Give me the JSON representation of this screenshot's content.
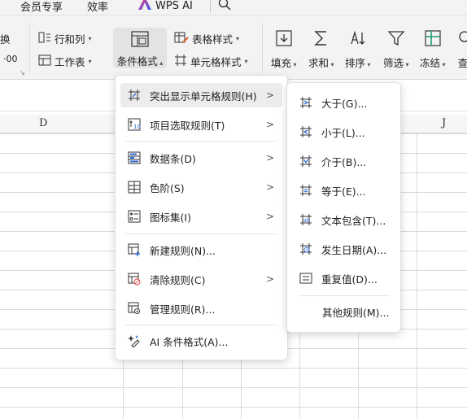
{
  "tabs": {
    "member": "会员专享",
    "efficiency": "效率",
    "wps_ai": "WPS AI"
  },
  "ribbon": {
    "left_partial_top": "换",
    "left_partial_bottom": "·00",
    "row_col": "行和列",
    "worksheet": "工作表",
    "conditional_format": "条件格式",
    "table_style": "表格样式",
    "cell_style": "单元格样式",
    "fill": "填充",
    "sum": "求和",
    "sort": "排序",
    "filter": "筛选",
    "freeze": "冻结",
    "find_partial": "查"
  },
  "columns": {
    "d": "D",
    "j": "J"
  },
  "menu": {
    "items": [
      {
        "label": "突出显示单元格规则(H)",
        "icon": "highlight-rules-icon",
        "has_submenu": true,
        "active": true
      },
      {
        "label": "项目选取规则(T)",
        "icon": "top-bottom-rules-icon",
        "has_submenu": true
      },
      {
        "label": "数据条(D)",
        "icon": "data-bars-icon",
        "has_submenu": true
      },
      {
        "label": "色阶(S)",
        "icon": "color-scales-icon",
        "has_submenu": true
      },
      {
        "label": "图标集(I)",
        "icon": "icon-sets-icon",
        "has_submenu": true
      },
      {
        "label": "新建规则(N)...",
        "icon": "new-rule-icon",
        "has_submenu": false
      },
      {
        "label": "清除规则(C)",
        "icon": "clear-rules-icon",
        "has_submenu": true
      },
      {
        "label": "管理规则(R)...",
        "icon": "manage-rules-icon",
        "has_submenu": false
      },
      {
        "label": "AI 条件格式(A)...",
        "icon": "ai-format-icon",
        "has_submenu": false
      }
    ]
  },
  "submenu": {
    "items": [
      {
        "label": "大于(G)...",
        "icon": "greater-than-icon"
      },
      {
        "label": "小于(L)...",
        "icon": "less-than-icon"
      },
      {
        "label": "介于(B)...",
        "icon": "between-icon"
      },
      {
        "label": "等于(E)...",
        "icon": "equal-to-icon"
      },
      {
        "label": "文本包含(T)...",
        "icon": "text-contains-icon"
      },
      {
        "label": "发生日期(A)...",
        "icon": "date-occurring-icon"
      },
      {
        "label": "重复值(D)...",
        "icon": "duplicate-values-icon"
      },
      {
        "label": "其他规则(M)...",
        "icon": ""
      }
    ]
  },
  "colors": {
    "wps_ai_gradient_start": "#e8407a",
    "wps_ai_gradient_end": "#3b5cf5",
    "accent_blue": "#2f6ad8"
  }
}
